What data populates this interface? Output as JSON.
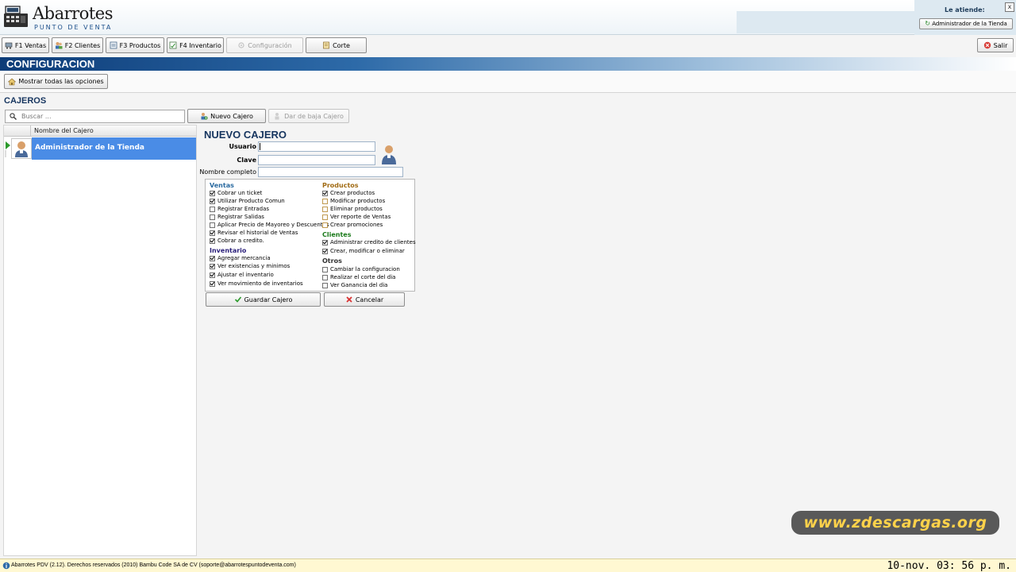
{
  "app": {
    "title": "Abarrotes",
    "subtitle": "PUNTO DE VENTA"
  },
  "header": {
    "attend_label": "Le atiende:",
    "attendant_button": "Administrador de la Tienda",
    "close_label": "x"
  },
  "toolbar": {
    "ventas": "F1 Ventas",
    "clientes": "F2 Clientes",
    "productos": "F3 Productos",
    "inventario": "F4 Inventario",
    "configuracion": "Configuración",
    "corte": "Corte",
    "salir": "Salir"
  },
  "section": {
    "title": "CONFIGURACION",
    "show_all_options": "Mostrar todas las opciones"
  },
  "cajeros": {
    "title": "CAJEROS",
    "search_placeholder": "Buscar ...",
    "new_button": "Nuevo Cajero",
    "remove_button": "Dar de baja Cajero",
    "column_header": "Nombre del Cajero",
    "rows": [
      {
        "name": "Administrador de la Tienda"
      }
    ]
  },
  "form": {
    "title": "NUEVO CAJERO",
    "usuario_label": "Usuario",
    "clave_label": "Clave",
    "nombre_label": "Nombre completo",
    "usuario_value": "",
    "clave_value": "",
    "nombre_value": "",
    "save_button": "Guardar Cajero",
    "cancel_button": "Cancelar"
  },
  "permissions": {
    "ventas": {
      "title": "Ventas",
      "items": [
        {
          "label": "Cobrar un ticket",
          "checked": true
        },
        {
          "label": "Utilizar Producto Comun",
          "checked": true
        },
        {
          "label": "Registrar Entradas",
          "checked": false
        },
        {
          "label": "Registrar Salidas",
          "checked": false
        },
        {
          "label": "Aplicar Precio de Mayoreo y Descuentos",
          "checked": false
        },
        {
          "label": "Revisar el historial de Ventas",
          "checked": true
        },
        {
          "label": "Cobrar a credito.",
          "checked": true
        }
      ]
    },
    "inventario": {
      "title": "Inventario",
      "items": [
        {
          "label": "Agregar mercancia",
          "checked": true
        },
        {
          "label": "Ver existencias y minimos",
          "checked": true
        },
        {
          "label": "Ajustar el inventario",
          "checked": true
        },
        {
          "label": "Ver movimiento de inventarios",
          "checked": true
        }
      ]
    },
    "productos": {
      "title": "Productos",
      "items": [
        {
          "label": "Crear productos",
          "checked": true
        },
        {
          "label": "Modificar  productos",
          "checked": false
        },
        {
          "label": "Eliminar productos",
          "checked": false
        },
        {
          "label": "Ver reporte de Ventas",
          "checked": false
        },
        {
          "label": "Crear promociones",
          "checked": false
        }
      ]
    },
    "clientes": {
      "title": "Clientes",
      "items": [
        {
          "label": "Administrar credito de clientes",
          "checked": true
        },
        {
          "label": "Crear, modificar o eliminar",
          "checked": true
        }
      ]
    },
    "otros": {
      "title": "Otros",
      "items": [
        {
          "label": "Cambiar la configuracion",
          "checked": false
        },
        {
          "label": "Realizar el corte del dia",
          "checked": false
        },
        {
          "label": "Ver Ganancia del dia",
          "checked": false
        }
      ]
    }
  },
  "watermark": "www.zdescargas.org",
  "status": {
    "text": "Abarrotes PDV (2.12). Derechos reservados (2010) Bambu Code SA de CV (soporte@abarrotespuntodeventa.com)",
    "clock": "10-nov. 03: 56 p. m."
  },
  "colors": {
    "banner_dark": "#0d3c78",
    "selection": "#4a8ce6",
    "title_blue": "#16355f",
    "watermark_text": "#ffd24a"
  },
  "icons": {
    "logo": "cash-register-icon",
    "salir": "exit-icon",
    "search": "magnifier-icon"
  }
}
